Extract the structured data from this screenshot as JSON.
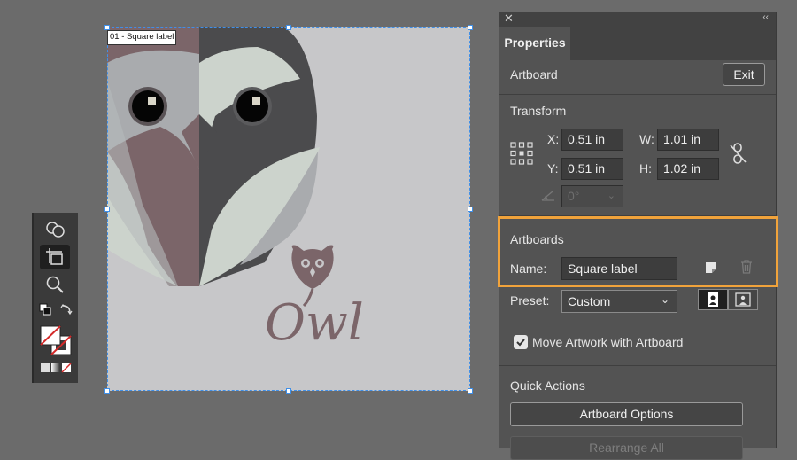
{
  "artboard": {
    "label": "01 - Square label",
    "logo_text": "Owl"
  },
  "colors": {
    "canvas": "#6b6b6b",
    "artboard": "#c7c7c9",
    "owl_mauve": "#7b6569",
    "owl_dark": "#4b4b4d",
    "owl_light": "#ccd3cc",
    "owl_gray": "#a9abae",
    "selection": "#3f8fe8",
    "highlight": "#f1a33b"
  },
  "panel": {
    "tab": "Properties",
    "artboard_title": "Artboard",
    "exit_label": "Exit",
    "transform": {
      "title": "Transform",
      "x_label": "X:",
      "x_value": "0.51 in",
      "y_label": "Y:",
      "y_value": "0.51 in",
      "w_label": "W:",
      "w_value": "1.01 in",
      "h_label": "H:",
      "h_value": "1.02 in",
      "angle_value": "0°"
    },
    "artboards": {
      "title": "Artboards",
      "name_label": "Name:",
      "name_value": "Square label",
      "preset_label": "Preset:",
      "preset_value": "Custom",
      "move_artwork_label": "Move Artwork with Artboard",
      "move_artwork_checked": true
    },
    "quick_actions": {
      "title": "Quick Actions",
      "artboard_options": "Artboard Options",
      "rearrange_all": "Rearrange All"
    }
  }
}
